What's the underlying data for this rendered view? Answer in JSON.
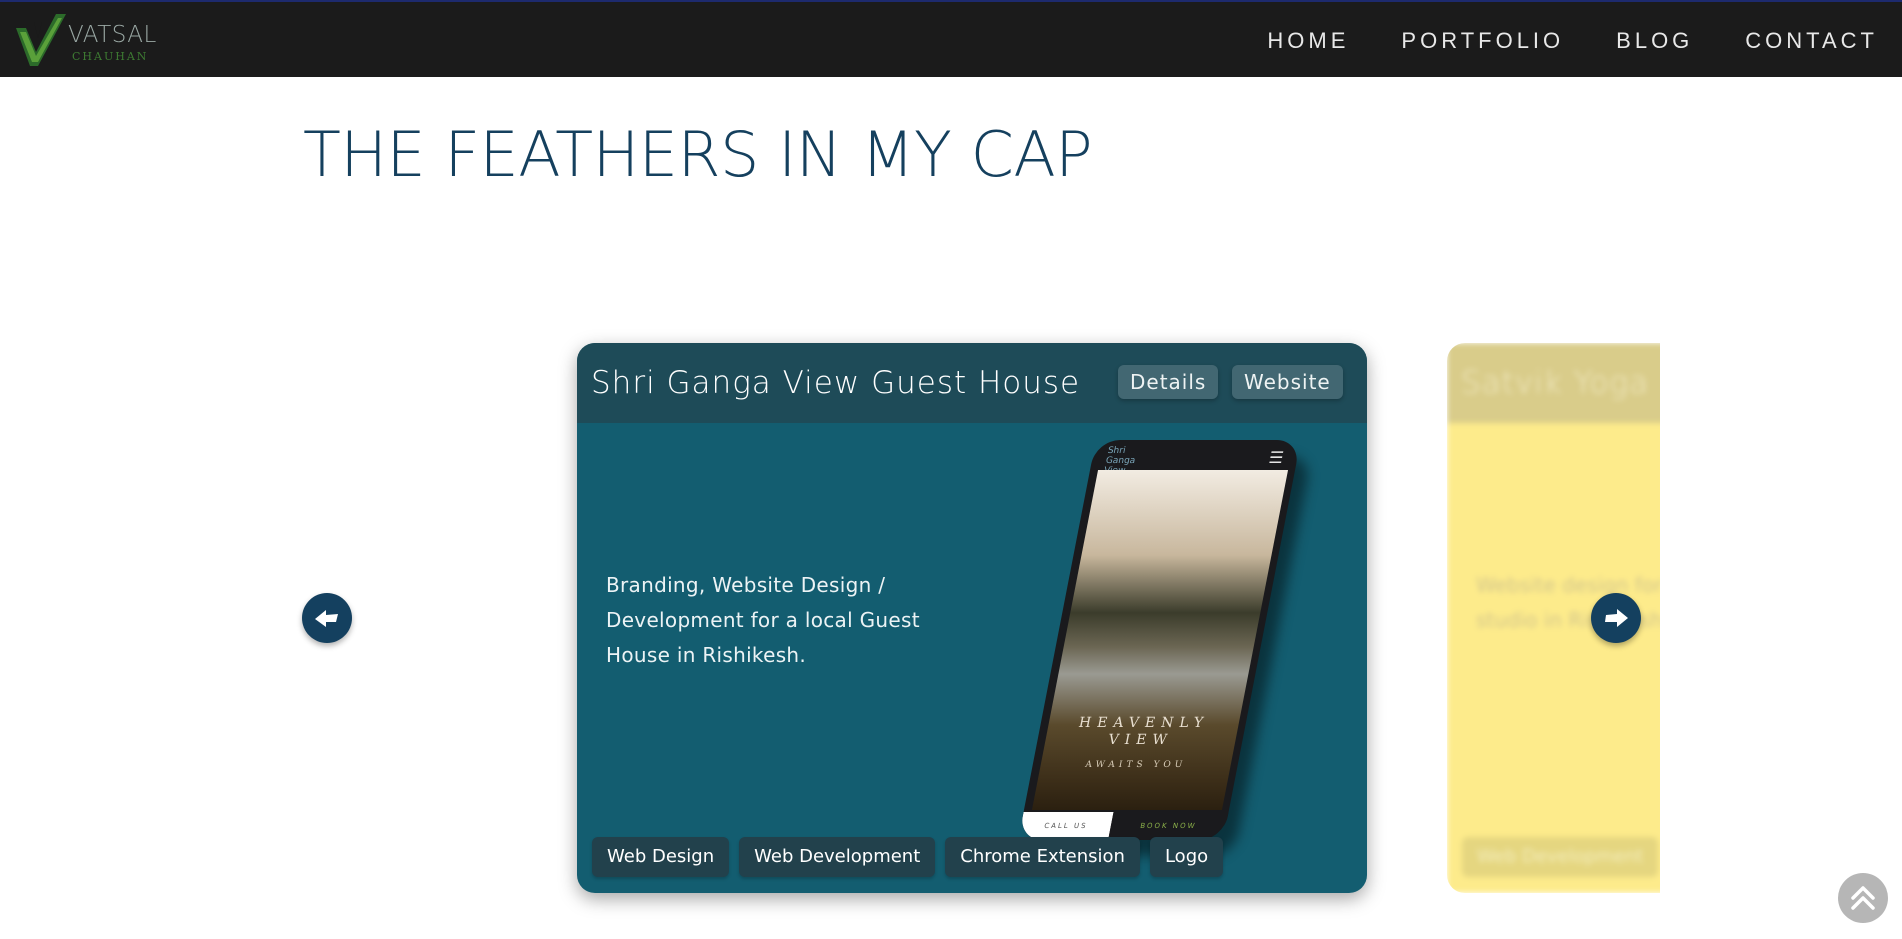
{
  "header": {
    "logo": {
      "name": "VATSAL",
      "sub": "CHAUHAN"
    },
    "nav": [
      {
        "label": "HOME"
      },
      {
        "label": "PORTFOLIO"
      },
      {
        "label": "BLOG"
      },
      {
        "label": "CONTACT"
      }
    ]
  },
  "page": {
    "title": "THE FEATHERS IN MY CAP"
  },
  "carousel": {
    "current": {
      "title": "Shri Ganga View Guest House",
      "details_label": "Details",
      "website_label": "Website",
      "description": "Branding, Website Design / Development for a local Guest House in Rishikesh.",
      "tags": [
        "Web Design",
        "Web Development",
        "Chrome Extension",
        "Logo"
      ],
      "mockup": {
        "logo_text": "Shri Ganga View",
        "headline": "HEAVENLY VIEW",
        "subline": "AWAITS YOU",
        "call_label": "CALL US",
        "book_label": "BOOK NOW"
      }
    },
    "next": {
      "title": "Satvik Yoga",
      "description": "Website design for a yoga studio in Rishikesh.",
      "tag": "Web Development"
    }
  },
  "colors": {
    "nav_bg": "#1b1b1b",
    "title": "#15405e",
    "card_bg": "#135d70",
    "card_header": "#1e4b58",
    "next_card_bg": "#fdeb8b",
    "arrow_bg": "#14405f"
  },
  "icons": {
    "prev": "arrow-left-icon",
    "next": "arrow-right-icon",
    "scroll_top": "double-chevron-up-icon",
    "menu": "hamburger-icon"
  }
}
